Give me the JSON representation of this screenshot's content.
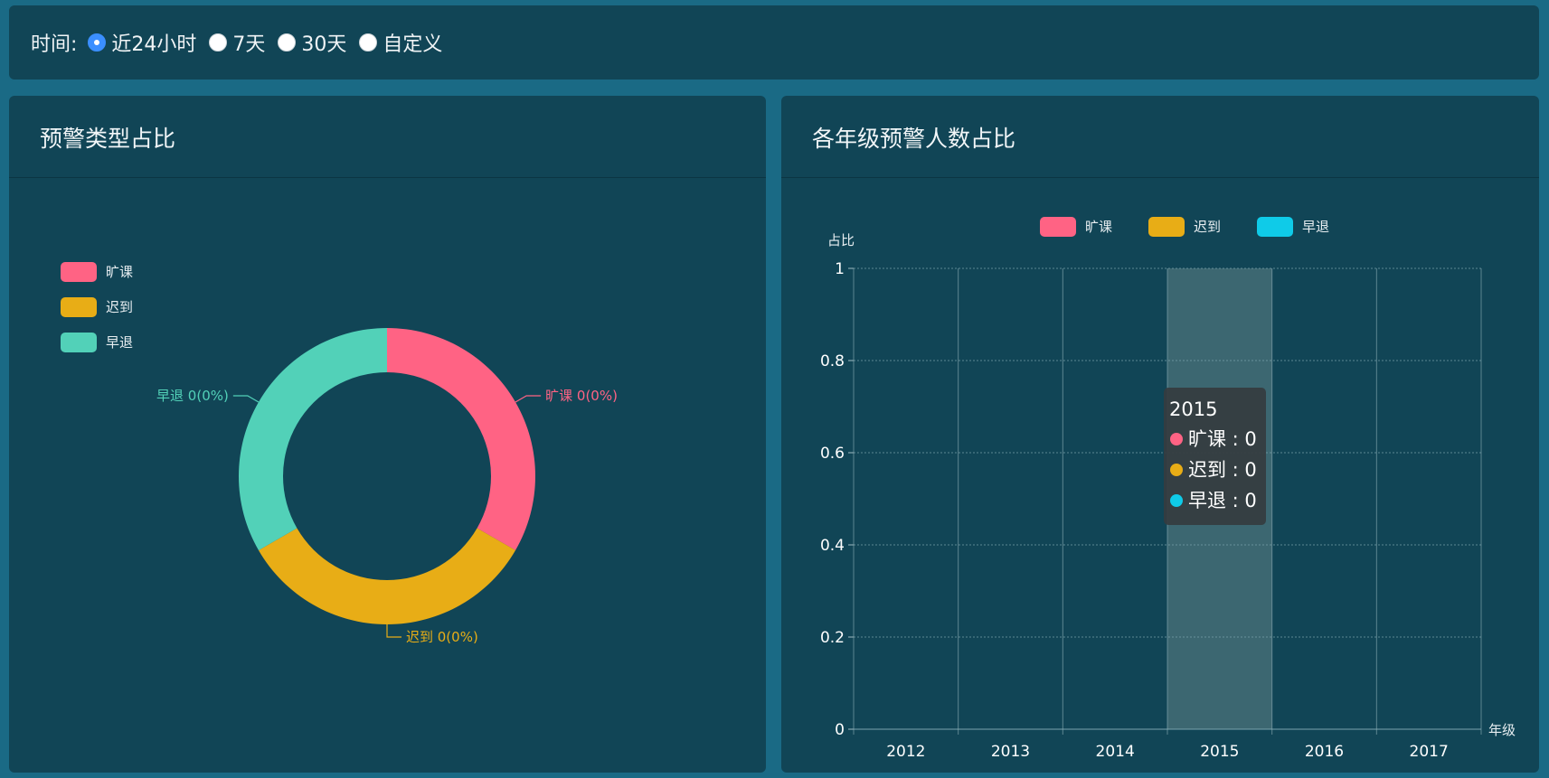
{
  "time_filter": {
    "label": "时间:",
    "options": [
      {
        "label": "近24小时",
        "checked": true
      },
      {
        "label": "7天",
        "checked": false
      },
      {
        "label": "30天",
        "checked": false
      },
      {
        "label": "自定义",
        "checked": false
      }
    ]
  },
  "left_panel": {
    "title": "预警类型占比"
  },
  "right_panel": {
    "title": "各年级预警人数占比"
  },
  "colors": {
    "absent": "#ff6384",
    "late": "#e8ad16",
    "early_pie": "#52d1b8",
    "early_bar": "#0fcbe8"
  },
  "chart_data": [
    {
      "type": "pie",
      "variant": "donut",
      "legend": [
        "旷课",
        "迟到",
        "早退"
      ],
      "slices": [
        {
          "name": "旷课",
          "value": 0,
          "label": "旷课 0(0%)"
        },
        {
          "name": "迟到",
          "value": 0,
          "label": "迟到 0(0%)"
        },
        {
          "name": "早退",
          "value": 0,
          "label": "早退 0(0%)"
        }
      ],
      "legend_position": "top-left"
    },
    {
      "type": "bar",
      "legend": [
        "旷课",
        "迟到",
        "早退"
      ],
      "legend_position": "top-center",
      "categories": [
        "2012",
        "2013",
        "2014",
        "2015",
        "2016",
        "2017"
      ],
      "series": [
        {
          "name": "旷课",
          "values": [
            0,
            0,
            0,
            0,
            0,
            0
          ]
        },
        {
          "name": "迟到",
          "values": [
            0,
            0,
            0,
            0,
            0,
            0
          ]
        },
        {
          "name": "早退",
          "values": [
            0,
            0,
            0,
            0,
            0,
            0
          ]
        }
      ],
      "ylabel": "占比",
      "xlabel": "年级",
      "ylim": [
        0,
        1
      ],
      "yticks": [
        "0",
        "0.2",
        "0.4",
        "0.6",
        "0.8",
        "1"
      ],
      "grid": true,
      "highlighted_category": "2015",
      "tooltip": {
        "title": "2015",
        "items": [
          {
            "name": "旷课",
            "value": "0"
          },
          {
            "name": "迟到",
            "value": "0"
          },
          {
            "name": "早退",
            "value": "0"
          }
        ]
      }
    }
  ]
}
